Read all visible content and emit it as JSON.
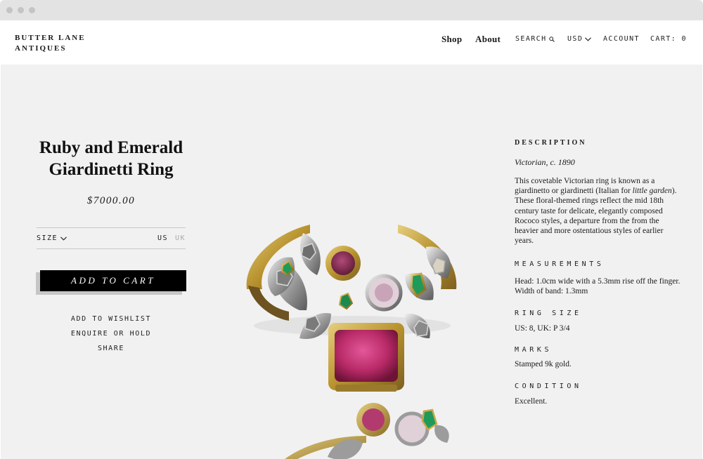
{
  "site": {
    "logo_line1": "BUTTER LANE",
    "logo_line2": "ANTIQUES"
  },
  "nav": {
    "shop": "Shop",
    "about": "About",
    "search": "SEARCH",
    "currency": "USD",
    "account": "ACCOUNT",
    "cart": "CART: 0"
  },
  "product": {
    "title": "Ruby and Emerald Giardinetti Ring",
    "price": "$7000.00",
    "size_label": "SIZE",
    "size_us": "US",
    "size_uk": "UK",
    "add_to_cart": "ADD TO CART",
    "wishlist": "ADD TO WISHLIST",
    "enquire": "ENQUIRE OR HOLD",
    "share": "SHARE"
  },
  "description": {
    "heading": "DESCRIPTION",
    "era": "Victorian, c. 1890",
    "body_part1": "This covetable Victorian ring is known as a giardinetto or giardinetti (Italian for ",
    "body_italic": "little garden",
    "body_part2": "). These floral-themed rings reflect the mid 18th century taste for delicate, elegantly composed Rococo styles, a departure from the from the heavier and more ostentatious styles of earlier years.",
    "measurements_heading": "MEASUREMENTS",
    "measurements": "Head: 1.0cm wide with a 5.3mm rise off the finger. Width of band: 1.3mm",
    "ring_size_heading": "RING SIZE",
    "ring_size": "US: 8, UK: P 3/4",
    "marks_heading": "MARKS",
    "marks": "Stamped 9k gold.",
    "condition_heading": "CONDITION",
    "condition": "Excellent."
  },
  "colors": {
    "page_background": "#f1f1f1",
    "header_background": "#ffffff",
    "button_background": "#000000",
    "ruby": "#c0306a",
    "emerald": "#1f9a5a",
    "gold": "#c9a84a"
  },
  "icons": {
    "search": "search-icon",
    "currency_dropdown": "chevron-down-icon",
    "size_dropdown": "chevron-down-icon"
  }
}
